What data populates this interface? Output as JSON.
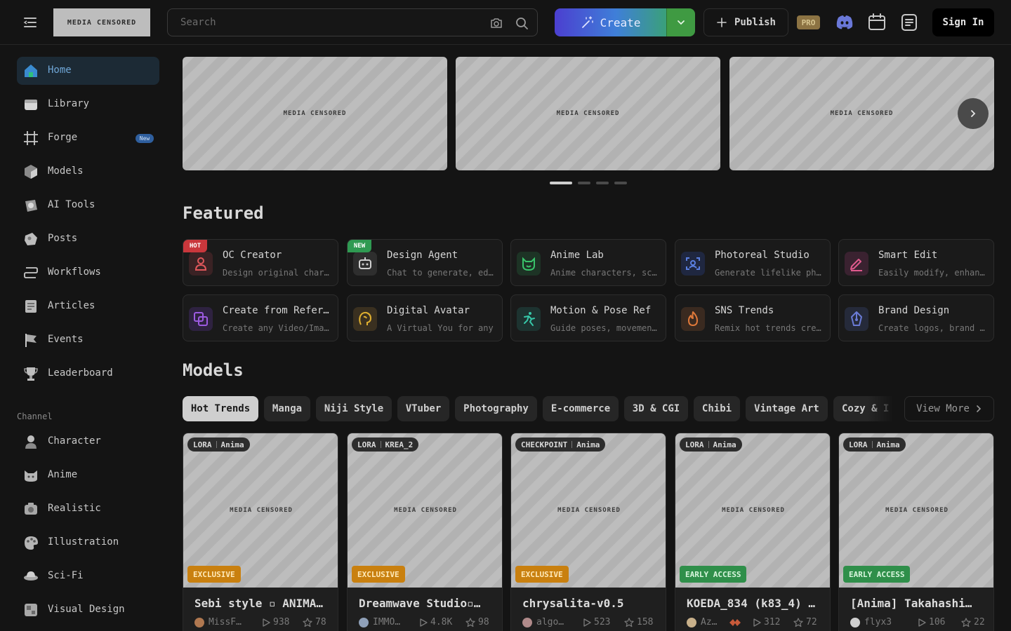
{
  "header": {
    "logo_text": "MEDIA CENSORED",
    "search_placeholder": "Search",
    "create_label": "Create",
    "publish_label": "Publish",
    "pro_label": "PRO",
    "signin_label": "Sign In",
    "icons": [
      "menu-icon",
      "camera-icon",
      "search-icon",
      "discord-icon",
      "calendar-icon",
      "document-icon"
    ]
  },
  "sidebar": {
    "items": [
      {
        "label": "Home",
        "icon": "home-icon"
      },
      {
        "label": "Library",
        "icon": "library-icon"
      },
      {
        "label": "Forge",
        "icon": "forge-icon",
        "badge": "New"
      },
      {
        "label": "Models",
        "icon": "models-icon"
      },
      {
        "label": "AI Tools",
        "icon": "ai-tools-icon"
      },
      {
        "label": "Posts",
        "icon": "posts-icon"
      },
      {
        "label": "Workflows",
        "icon": "workflows-icon"
      },
      {
        "label": "Articles",
        "icon": "articles-icon"
      },
      {
        "label": "Events",
        "icon": "events-icon"
      },
      {
        "label": "Leaderboard",
        "icon": "trophy-icon"
      }
    ],
    "channel_title": "Channel",
    "channels": [
      {
        "label": "Character",
        "icon": "character-icon"
      },
      {
        "label": "Anime",
        "icon": "anime-icon"
      },
      {
        "label": "Realistic",
        "icon": "realistic-icon"
      },
      {
        "label": "Illustration",
        "icon": "illustration-icon"
      },
      {
        "label": "Sci-Fi",
        "icon": "scifi-icon"
      },
      {
        "label": "Visual Design",
        "icon": "visual-design-icon"
      }
    ]
  },
  "banner": {
    "slides": [
      "MEDIA CENSORED",
      "MEDIA CENSORED",
      "MEDIA CENSORED"
    ],
    "dot_count": 4,
    "active_dot": 0
  },
  "featured": {
    "title": "Featured",
    "cards": [
      {
        "title": "OC Creator",
        "desc": "Design original characters",
        "tag": "HOT",
        "color": "#e0575b"
      },
      {
        "title": "Design Agent",
        "desc": "Chat to generate, edit",
        "tag": "NEW",
        "color": "#cfcfcf"
      },
      {
        "title": "Anime Lab",
        "desc": "Anime characters, scenes",
        "tag": "",
        "color": "#39c46b"
      },
      {
        "title": "Photoreal Studio",
        "desc": "Generate lifelike photos",
        "tag": "",
        "color": "#5a7fe0"
      },
      {
        "title": "Smart Edit",
        "desc": "Easily modify, enhance",
        "tag": "",
        "color": "#e05a8d"
      },
      {
        "title": "Create from Reference",
        "desc": "Create any Video/Image",
        "tag": "",
        "color": "#9c5ae0"
      },
      {
        "title": "Digital Avatar",
        "desc": "A Virtual You for any",
        "tag": "",
        "color": "#e0b030"
      },
      {
        "title": "Motion & Pose Ref",
        "desc": "Guide poses, movements",
        "tag": "",
        "color": "#36c7a8"
      },
      {
        "title": "SNS Trends",
        "desc": "Remix hot trends creatively",
        "tag": "",
        "color": "#e0793a"
      },
      {
        "title": "Brand Design",
        "desc": "Create logos, brand assets",
        "tag": "",
        "color": "#6a7bd6"
      }
    ]
  },
  "models": {
    "title": "Models",
    "chips": [
      "Hot Trends",
      "Manga",
      "Niji Style",
      "VTuber",
      "Photography",
      "E-commerce",
      "3D & CGI",
      "Chibi",
      "Vintage Art",
      "Cozy & I"
    ],
    "active_chip": 0,
    "view_more": "View More",
    "cards": [
      {
        "type": "LORA",
        "base": "Anima",
        "image": "MEDIA CENSORED",
        "access": "EXCLUSIVE",
        "title": "Sebi style ▫ ANIMA…",
        "author": "MissF…",
        "runs": "938",
        "stars": "78"
      },
      {
        "type": "LORA",
        "base": "KREA_2",
        "image": "MEDIA CENSORED",
        "access": "EXCLUSIVE",
        "title": "Dreamwave Studio▫…",
        "author": "IMMO…",
        "runs": "4.8K",
        "stars": "98"
      },
      {
        "type": "CHECKPOINT",
        "base": "Anima",
        "image": "MEDIA CENSORED",
        "access": "EXCLUSIVE",
        "title": "chrysalita-v0.5",
        "author": "algo…",
        "runs": "523",
        "stars": "158"
      },
      {
        "type": "LORA",
        "base": "Anima",
        "image": "MEDIA CENSORED",
        "access": "EARLY ACCESS",
        "title": "KOEDA_834 (k83_4) …",
        "author": "Az…",
        "runs": "312",
        "stars": "72"
      },
      {
        "type": "LORA",
        "base": "Anima",
        "image": "MEDIA CENSORED",
        "access": "EARLY ACCESS",
        "title": "[Anima] Takahashi…",
        "author": "flyx3",
        "runs": "106",
        "stars": "22"
      }
    ]
  }
}
